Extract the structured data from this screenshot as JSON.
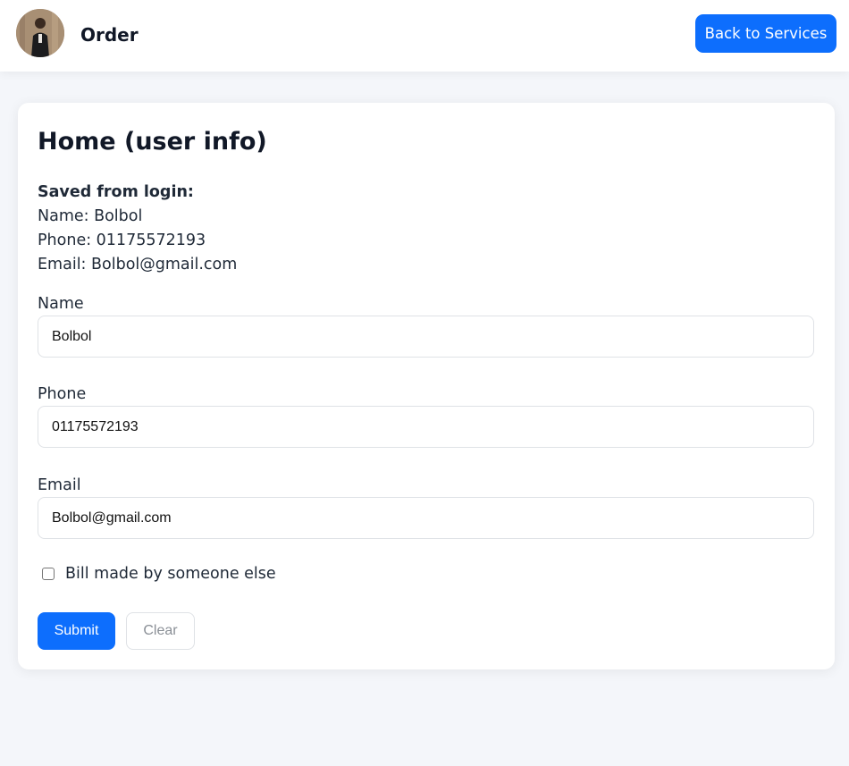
{
  "header": {
    "title": "Order",
    "back_label": "Back to Services",
    "avatar_icon": "user-photo"
  },
  "card": {
    "title": "Home (user info)",
    "saved_heading": "Saved from login:",
    "saved_name": "Name: Bolbol",
    "saved_phone": "Phone: 01175572193",
    "saved_email": "Email: Bolbol@gmail.com"
  },
  "form": {
    "name_label": "Name",
    "name_value": "Bolbol",
    "phone_label": "Phone",
    "phone_value": "01175572193",
    "email_label": "Email",
    "email_value": "Bolbol@gmail.com",
    "checkbox_label": "Bill made by someone else",
    "checkbox_checked": false,
    "submit_label": "Submit",
    "clear_label": "Clear"
  },
  "colors": {
    "accent": "#0d6efd",
    "background": "#f4f6fa",
    "card": "#ffffff",
    "text": "#111827"
  }
}
